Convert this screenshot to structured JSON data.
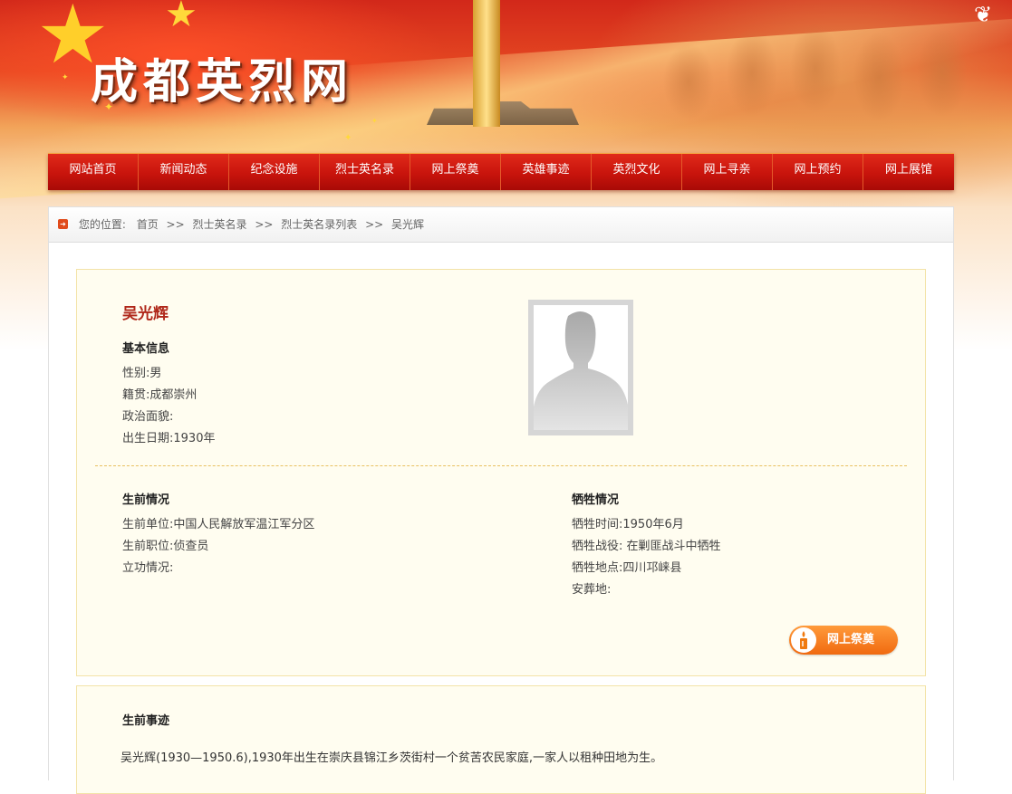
{
  "site": {
    "title": "成都英烈网"
  },
  "nav": {
    "items": [
      "网站首页",
      "新闻动态",
      "纪念设施",
      "烈士英名录",
      "网上祭奠",
      "英雄事迹",
      "英烈文化",
      "网上寻亲",
      "网上预约",
      "网上展馆"
    ]
  },
  "breadcrumb": {
    "prefix": "您的位置:",
    "items": [
      "首页",
      "烈士英名录",
      "烈士英名录列表",
      "吴光辉"
    ],
    "separator": ">>"
  },
  "hero": {
    "name": "吴光辉",
    "basic": {
      "heading": "基本信息",
      "gender": "性别:男",
      "hometown": "籍贯:成都崇州",
      "political": "政治面貌:",
      "birth": "出生日期:1930年"
    },
    "before": {
      "heading": "生前情况",
      "unit": "生前单位:中国人民解放军温江军分区",
      "post": "生前职位:侦查员",
      "merit": "立功情况:"
    },
    "sacrifice": {
      "heading": "牺牲情况",
      "time": "牺牲时间:1950年6月",
      "battle": "牺牲战役: 在剿匪战斗中牺牲",
      "place": "牺牲地点:四川邛崃县",
      "burial": "安葬地:"
    },
    "worship_button": "网上祭奠"
  },
  "life": {
    "heading": "生前事迹",
    "text": "吴光辉(1930—1950.6),1930年出生在崇庆县锦江乡茨街村一个贫苦农民家庭,一家人以租种田地为生。"
  },
  "colors": {
    "nav_red": "#c8140c",
    "name_red": "#b0281a",
    "card_bg": "#fffdf0",
    "button_orange": "#f06a10"
  }
}
